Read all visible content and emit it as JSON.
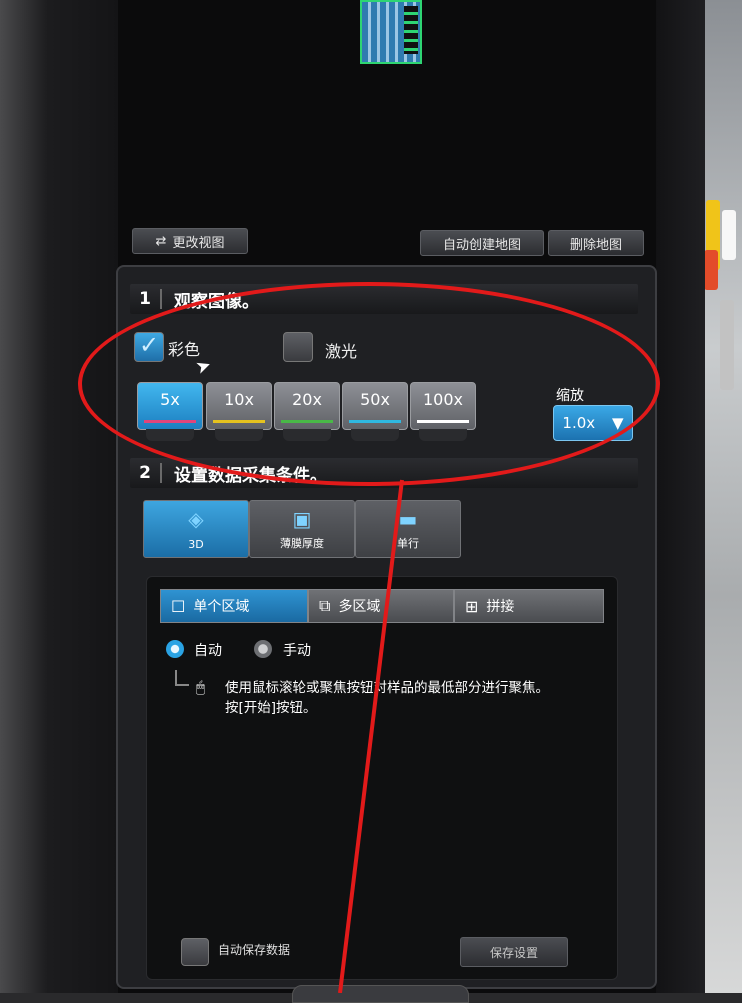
{
  "top_toolbar": {
    "change_view": "更改视图",
    "auto_create_map": "自动创建地图",
    "delete_map": "删除地图"
  },
  "section1": {
    "number": "1",
    "title": "观察图像。",
    "color_label": "彩色",
    "color_checked": true,
    "laser_label": "激光",
    "laser_checked": false,
    "magnifications": [
      {
        "label": "5x",
        "selected": true,
        "color": "#e0457b"
      },
      {
        "label": "10x",
        "selected": false,
        "color": "#e5c21f"
      },
      {
        "label": "20x",
        "selected": false,
        "color": "#49b847"
      },
      {
        "label": "50x",
        "selected": false,
        "color": "#2fb8e0"
      },
      {
        "label": "100x",
        "selected": false,
        "color": "#ffffff"
      }
    ],
    "zoom_label": "缩放",
    "zoom_value": "1.0x"
  },
  "section2": {
    "number": "2",
    "title": "设置数据采集条件。",
    "modes": [
      {
        "label": "3D",
        "selected": true,
        "icon": "layers-icon"
      },
      {
        "label": "薄膜厚度",
        "selected": false,
        "icon": "film-icon"
      },
      {
        "label": "单行",
        "selected": false,
        "icon": "line-icon"
      }
    ],
    "region_tabs": [
      {
        "label": "单个区域",
        "selected": true,
        "icon": "square-icon"
      },
      {
        "label": "多区域",
        "selected": false,
        "icon": "multi-square-icon"
      },
      {
        "label": "拼接",
        "selected": false,
        "icon": "grid-icon"
      }
    ],
    "focus_auto": "自动",
    "focus_manual": "手动",
    "focus_selected": "自动",
    "hint_line1": "使用鼠标滚轮或聚焦按钮对样品的最低部分进行聚焦。",
    "hint_line2": "按[开始]按钮。"
  },
  "footer": {
    "auto_save_label": "自动保存数据",
    "auto_save_checked": false,
    "save_settings": "保存设置"
  },
  "colors": {
    "accent_blue": "#2aa3e4",
    "annotation_red": "#e21a1a"
  }
}
